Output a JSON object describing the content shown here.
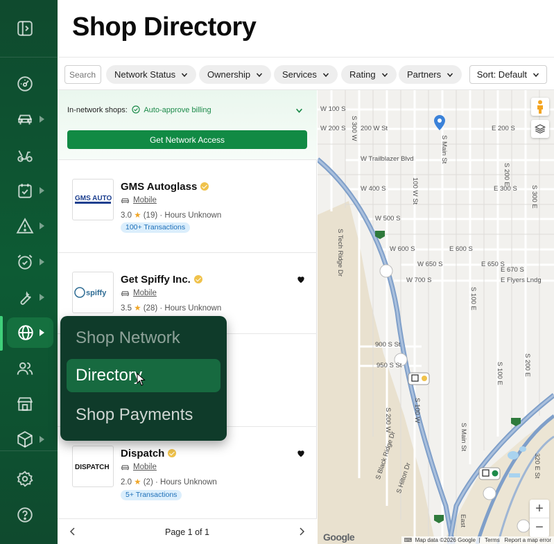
{
  "page": {
    "title": "Shop Directory"
  },
  "sidebar": {
    "icons": [
      "sidebar-toggle-icon",
      "dashboard-icon",
      "car-icon",
      "scooter-icon",
      "calendar-check-icon",
      "warning-icon",
      "alarm-clock-icon",
      "wrench-icon",
      "globe-icon",
      "users-icon",
      "store-icon",
      "box-icon",
      "settings-icon",
      "help-icon"
    ]
  },
  "filters": {
    "search_placeholder": "Search",
    "chips": [
      "Network Status",
      "Ownership",
      "Services",
      "Rating",
      "Partners"
    ],
    "sort_label": "Sort: Default"
  },
  "banner": {
    "label": "In-network shops:",
    "status": "Auto-approve billing",
    "button": "Get Network Access"
  },
  "shops": [
    {
      "name": "GMS Autoglass",
      "service": "Mobile",
      "rating": "3.0",
      "reviews": "(19)",
      "hours": "· Hours Unknown",
      "badge": "100+ Transactions",
      "logo": "GMS AUTOGLASS",
      "favorite": false
    },
    {
      "name": "Get Spiffy Inc.",
      "service": "Mobile",
      "rating": "3.5",
      "reviews": "(28)",
      "hours": "· Hours Unknown",
      "badge": "",
      "logo": "spiffy",
      "favorite": true
    },
    {
      "name": "Dispatch",
      "service": "Mobile",
      "rating": "2.0",
      "reviews": "(2)",
      "hours": "· Hours Unknown",
      "badge": "5+ Transactions",
      "logo": "DISPATCH",
      "favorite": true
    }
  ],
  "pager": {
    "text": "Page 1 of 1"
  },
  "popup_menu": {
    "items": [
      "Shop Network",
      "Directory",
      "Shop Payments"
    ],
    "active": "Directory"
  },
  "map": {
    "streets": [
      "W 100 S",
      "W 200 S",
      "200 W St",
      "S 300 W",
      "S Main St",
      "W Trailblazer Blvd",
      "W 400 S",
      "100 W St",
      "E 200 S",
      "S 200 E",
      "S 300 E",
      "E 300 S",
      "W 500 S",
      "S Tech Ridge Dr",
      "W 600 S",
      "E 600 S",
      "E 650 S",
      "W 650 S",
      "W 700 S",
      "E 670 S",
      "E Flyers Lndg",
      "S 100 E",
      "900 S St",
      "950 S St",
      "S 100 W",
      "S 200 W",
      "S 200 E",
      "S 100 E",
      "S Main St",
      "S Black Ridge Dr",
      "S Hilton Dr",
      "320 E St",
      "East"
    ],
    "highway_shields": [
      "15",
      "15",
      "15"
    ],
    "attribution": "Map data ©2026 Google",
    "terms": "Terms",
    "report": "Report a map error",
    "google": "Google",
    "zoom_in": "+",
    "zoom_out": "−"
  },
  "colors": {
    "brand_green": "#118a44",
    "sidebar_bg": "#0f4a2e",
    "popup_bg": "#0f3b2a",
    "active_item": "#176a40"
  }
}
